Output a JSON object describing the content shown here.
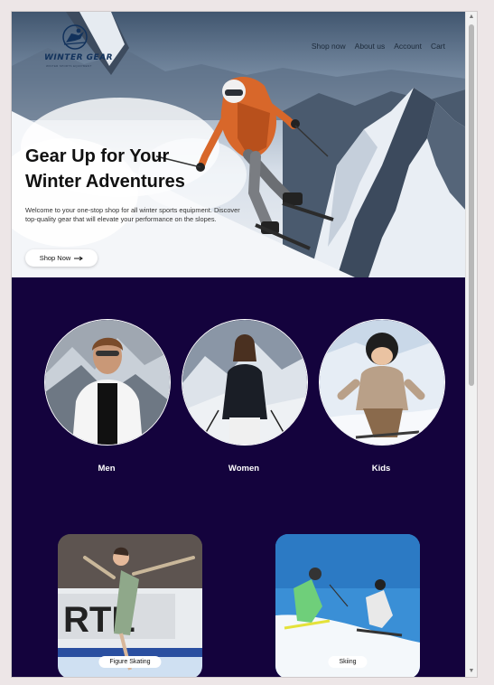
{
  "brand": {
    "name": "WINTER GEAR",
    "tagline": "WINTER SPORTS EQUIPMENT"
  },
  "nav": {
    "items": [
      "Shop now",
      "About us",
      "Account",
      "Cart"
    ]
  },
  "hero": {
    "title_line1": "Gear Up for Your",
    "title_line2": "Winter Adventures",
    "description": "Welcome to your one-stop shop for all winter sports equipment. Discover top-quality gear that will elevate your performance on the slopes.",
    "button_label": "Shop Now",
    "button_icon": "arrow-right-icon"
  },
  "categories": [
    {
      "label": "Men"
    },
    {
      "label": "Women"
    },
    {
      "label": "Kids"
    }
  ],
  "sports": [
    {
      "label": "Figure Skating"
    },
    {
      "label": "Skiing"
    }
  ],
  "colors": {
    "dark_section": "#14033d",
    "button_bg": "#ffffff",
    "accent_orange": "#d8672a"
  }
}
